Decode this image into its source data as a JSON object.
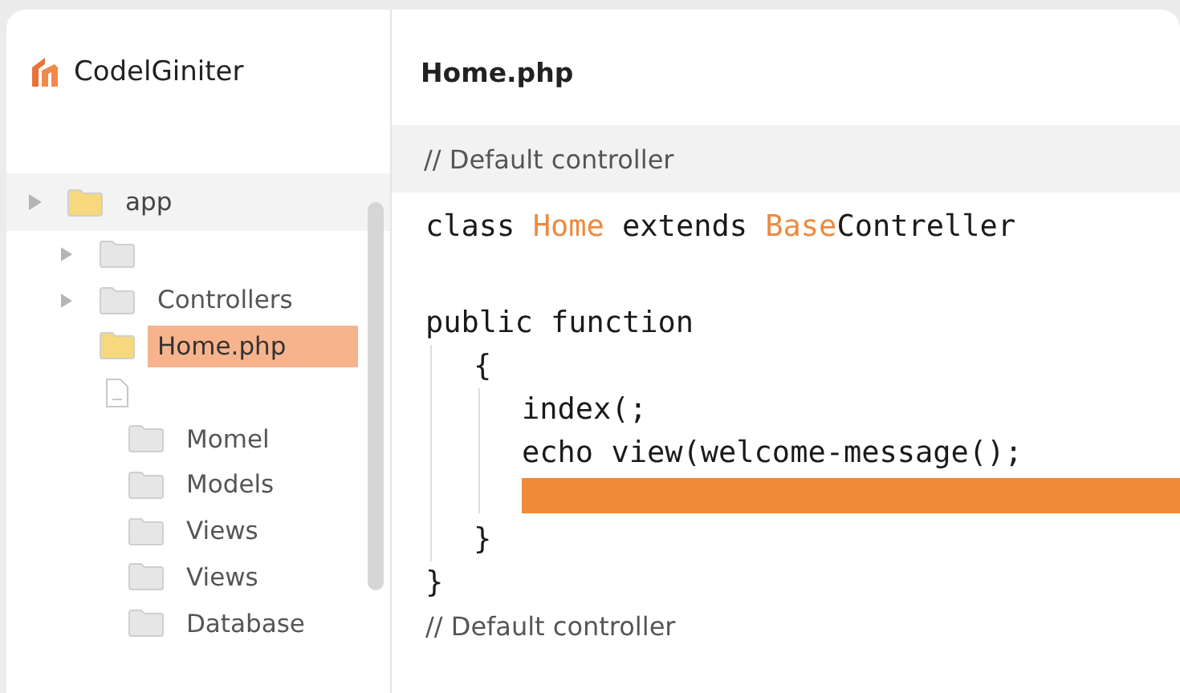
{
  "app": {
    "name": "CodelGiniter"
  },
  "tree": [
    {
      "label": "app",
      "kind": "folder",
      "color": "#f6d97c",
      "expander": true,
      "selected": false,
      "children": [
        {
          "kind": "folder",
          "color": "#e6e6e6",
          "expander": true,
          "selected": false
        },
        {
          "label": "Controllers",
          "kind": "folder",
          "color": "#e6e6e6",
          "expander": true,
          "selected": false
        },
        {
          "label": "Home.php",
          "kind": "folder",
          "color": "#f6d97c",
          "expander": false,
          "selected": true
        },
        {
          "kind": "file",
          "expander": false,
          "selected": false,
          "children": [
            {
              "label": "Momel",
              "kind": "folder",
              "color": "#e6e6e6",
              "selected": false
            },
            {
              "label": "Models",
              "kind": "folder",
              "color": "#e6e6e6",
              "selected": false
            },
            {
              "label": "Views",
              "kind": "folder",
              "color": "#e6e6e6",
              "selected": false
            },
            {
              "label": "Views",
              "kind": "folder",
              "color": "#e6e6e6",
              "selected": false
            },
            {
              "label": "Database",
              "kind": "folder",
              "color": "#e6e6e6",
              "selected": false
            }
          ]
        }
      ]
    }
  ],
  "editor": {
    "title": "Home.php",
    "header_comment": "// Default controller",
    "lines": [
      {
        "kind": "code",
        "segments": [
          {
            "text": "class ",
            "kind": "plain"
          },
          {
            "text": "Home",
            "kind": "type"
          },
          {
            "text": " extends ",
            "kind": "plain"
          },
          {
            "text": "Base",
            "kind": "type"
          },
          {
            "text": "Contreller",
            "kind": "plain"
          }
        ]
      },
      {
        "kind": "blank"
      },
      {
        "kind": "code",
        "segments": [
          {
            "text": "public function",
            "kind": "plain"
          }
        ],
        "children": [
          {
            "kind": "code",
            "segments": [
              {
                "text": "{",
                "kind": "plain"
              }
            ],
            "children": [
              {
                "kind": "code",
                "segments": [
                  {
                    "text": "index(;",
                    "kind": "plain"
                  }
                ]
              },
              {
                "kind": "code",
                "segments": [
                  {
                    "text": "echo view(welcome-message();",
                    "kind": "plain"
                  }
                ]
              },
              {
                "kind": "highlight"
              }
            ]
          },
          {
            "kind": "code",
            "segments": [
              {
                "text": "}",
                "kind": "plain"
              }
            ]
          }
        ]
      },
      {
        "kind": "code",
        "segments": [
          {
            "text": "}",
            "kind": "plain"
          }
        ]
      },
      {
        "kind": "comment",
        "segments": [
          {
            "text": "// Default controller",
            "kind": "plain"
          }
        ]
      }
    ]
  }
}
